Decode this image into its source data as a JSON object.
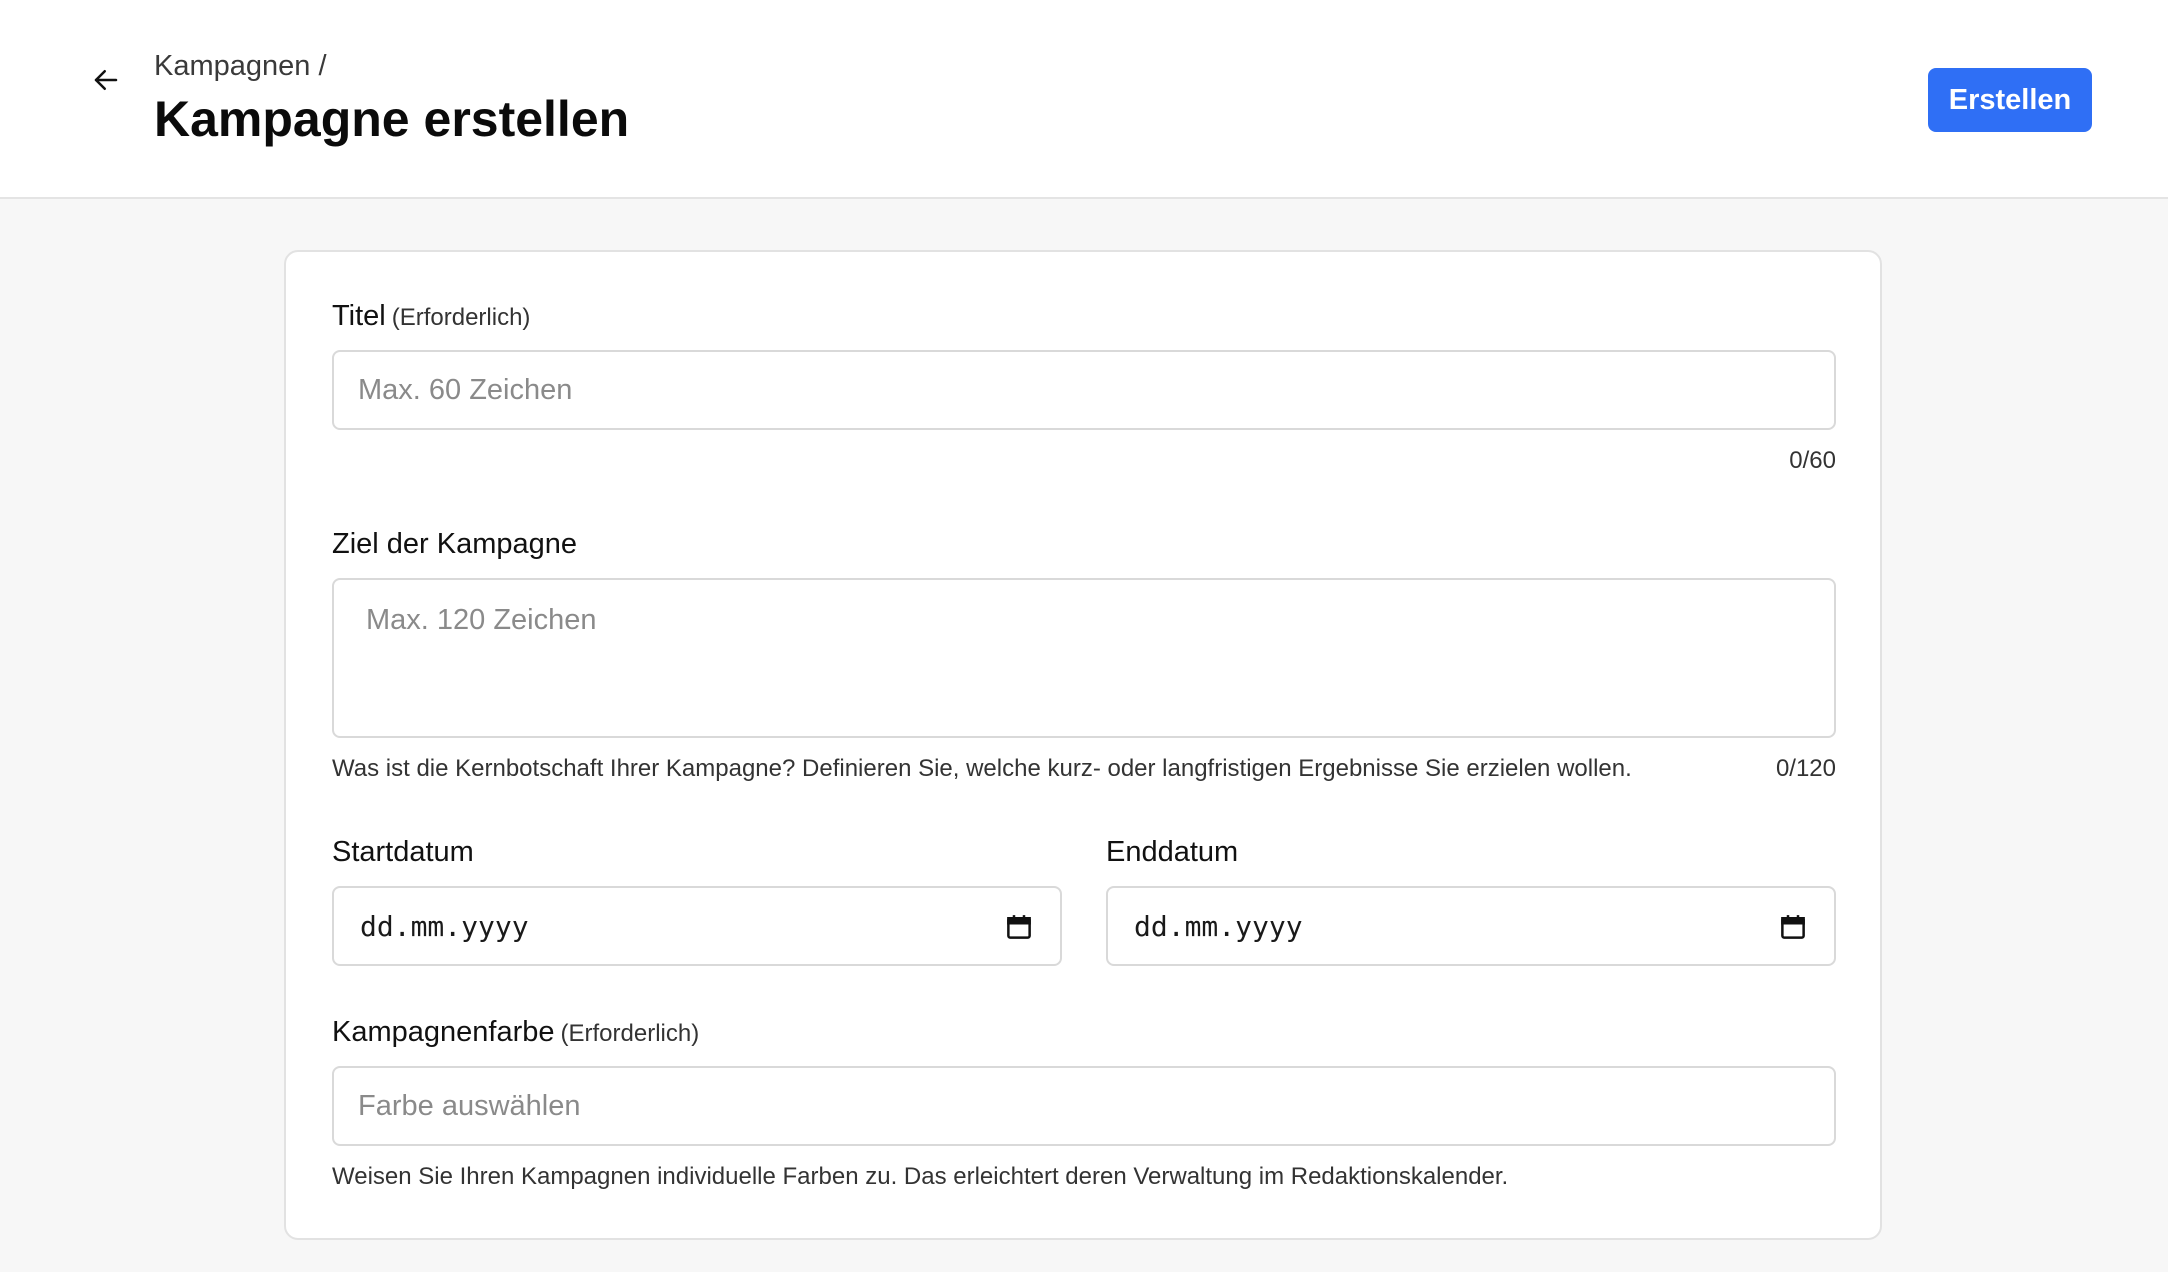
{
  "header": {
    "breadcrumb": "Kampagnen /",
    "title": "Kampagne erstellen",
    "create_button": "Erstellen",
    "back_icon": "arrow-left-icon",
    "accent_color": "#2f6ff5"
  },
  "form": {
    "title_field": {
      "label": "Titel",
      "required": "(Erforderlich)",
      "placeholder": "Max. 60 Zeichen",
      "counter": "0/60"
    },
    "goal_field": {
      "label": "Ziel der Kampagne",
      "placeholder": "Max. 120 Zeichen",
      "helper": "Was ist die Kernbotschaft Ihrer Kampagne? Definieren Sie, welche kurz- oder langfristigen Ergebnisse Sie erzielen wollen.",
      "counter": "0/120"
    },
    "start_date": {
      "label": "Startdatum",
      "value": "dd.mm.yyyy",
      "icon": "calendar-icon"
    },
    "end_date": {
      "label": "Enddatum",
      "value": "dd.mm.yyyy",
      "icon": "calendar-icon"
    },
    "color_field": {
      "label": "Kampagnenfarbe",
      "required": "(Erforderlich)",
      "placeholder": "Farbe auswählen",
      "helper": "Weisen Sie Ihren Kampagnen individuelle Farben zu. Das erleichtert deren Verwaltung im Redaktionskalender."
    }
  }
}
